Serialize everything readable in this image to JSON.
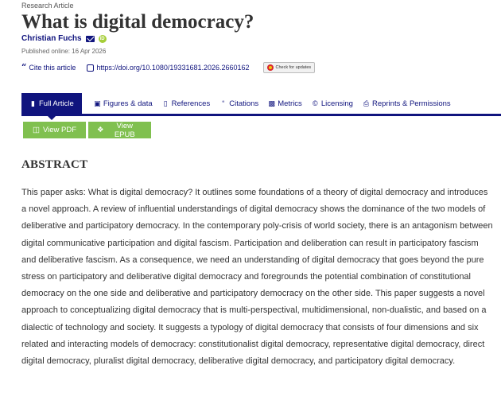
{
  "article": {
    "type_label": "Research Article",
    "title": "What is digital democracy?",
    "author": "Christian Fuchs",
    "published": "Published online: 16 Apr 2026",
    "cite_label": "Cite this article",
    "doi": "https://doi.org/10.1080/19331681.2026.2660162",
    "check_updates": "Check for updates"
  },
  "icons": {
    "mail": "envelope-icon",
    "orcid": "orcid-icon",
    "cite": "quote-icon",
    "doi": "link-icon",
    "check": "crossmark-icon"
  },
  "tabs": [
    {
      "label": "Full Article",
      "icon": "document-icon",
      "active": true
    },
    {
      "label": "Figures & data",
      "icon": "image-icon",
      "active": false
    },
    {
      "label": "References",
      "icon": "book-icon",
      "active": false
    },
    {
      "label": "Citations",
      "icon": "quote-icon",
      "active": false
    },
    {
      "label": "Metrics",
      "icon": "bar-chart-icon",
      "active": false
    },
    {
      "label": "Licensing",
      "icon": "copyright-icon",
      "active": false
    },
    {
      "label": "Reprints & Permissions",
      "icon": "print-icon",
      "active": false
    }
  ],
  "buttons": {
    "pdf": "View PDF",
    "epub": "View EPUB"
  },
  "abstract": {
    "heading": "ABSTRACT",
    "text": "This paper asks: What is digital democracy? It outlines some foundations of a theory of digital democracy and introduces a novel approach. A review of influential understandings of digital democracy shows the dominance of the two models of deliberative and participatory democracy. In the contemporary poly-crisis of world society, there is an antagonism between digital communicative participation and digital fascism. Participation and deliberation can result in participatory fascism and deliberative fascism. As a consequence, we need an understanding of digital democracy that goes beyond the pure stress on participatory and deliberative digital democracy and foregrounds the potential combination of constitutional democracy on the one side and deliberative and participatory democracy on the other side. This paper suggests a novel approach to conceptualizing digital democracy that is multi-perspectival, multidimensional, non-dualistic, and based on a dialectic of technology and society. It suggests a typology of digital democracy that consists of four dimensions and six related and interacting models of democracy: constitutionalist digital democracy, representative digital democracy, direct digital democracy, pluralist digital democracy, deliberative digital democracy, and participatory digital democracy."
  },
  "colors": {
    "brand": "#10147e",
    "button_green": "#80c04f",
    "text": "#333333",
    "orcid": "#a6ce39"
  }
}
